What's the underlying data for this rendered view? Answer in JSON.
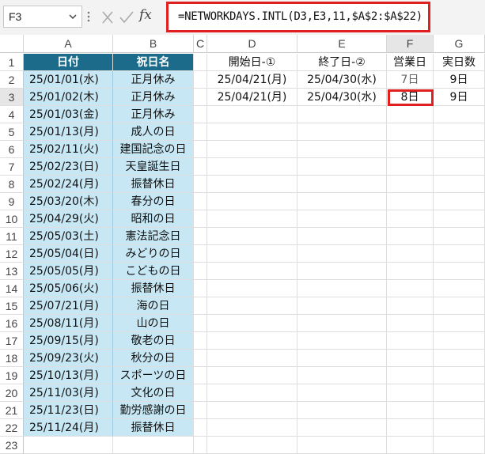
{
  "formula_bar": {
    "name_box": "F3",
    "formula": "=NETWORKDAYS.INTL(D3,E3,11,$A$2:$A$22)",
    "fx_label": "fx"
  },
  "columns": [
    "A",
    "B",
    "C",
    "D",
    "E",
    "F",
    "G"
  ],
  "row_numbers": [
    "1",
    "2",
    "3",
    "4",
    "5",
    "6",
    "7",
    "8",
    "9",
    "10",
    "11",
    "12",
    "13",
    "14",
    "15",
    "16",
    "17",
    "18",
    "19",
    "20",
    "21",
    "22",
    "23"
  ],
  "header_row": {
    "A": "日付",
    "B": "祝日名",
    "D": "開始日-①",
    "E": "終了日-②",
    "F": "営業日",
    "G": "実日数"
  },
  "results": [
    {
      "D": "25/04/21(月)",
      "E": "25/04/30(水)",
      "F": "7日",
      "G": "9日"
    },
    {
      "D": "25/04/21(月)",
      "E": "25/04/30(水)",
      "F": "8日",
      "G": "9日"
    }
  ],
  "holidays": [
    {
      "date": "25/01/01(水)",
      "name": "正月休み"
    },
    {
      "date": "25/01/02(木)",
      "name": "正月休み"
    },
    {
      "date": "25/01/03(金)",
      "name": "正月休み"
    },
    {
      "date": "25/01/13(月)",
      "name": "成人の日"
    },
    {
      "date": "25/02/11(火)",
      "name": "建国記念の日"
    },
    {
      "date": "25/02/23(日)",
      "name": "天皇誕生日"
    },
    {
      "date": "25/02/24(月)",
      "name": "振替休日"
    },
    {
      "date": "25/03/20(木)",
      "name": "春分の日"
    },
    {
      "date": "25/04/29(火)",
      "name": "昭和の日"
    },
    {
      "date": "25/05/03(土)",
      "name": "憲法記念日"
    },
    {
      "date": "25/05/04(日)",
      "name": "みどりの日"
    },
    {
      "date": "25/05/05(月)",
      "name": "こどもの日"
    },
    {
      "date": "25/05/06(火)",
      "name": "振替休日"
    },
    {
      "date": "25/07/21(月)",
      "name": "海の日"
    },
    {
      "date": "25/08/11(月)",
      "name": "山の日"
    },
    {
      "date": "25/09/15(月)",
      "name": "敬老の日"
    },
    {
      "date": "25/09/23(火)",
      "name": "秋分の日"
    },
    {
      "date": "25/10/13(月)",
      "name": "スポーツの日"
    },
    {
      "date": "25/11/03(月)",
      "name": "文化の日"
    },
    {
      "date": "25/11/23(日)",
      "name": "勤労感謝の日"
    },
    {
      "date": "25/11/24(月)",
      "name": "振替休日"
    }
  ],
  "colors": {
    "header_fill": "#1d6b8a",
    "data_fill": "#c7e7f4",
    "highlight": "#e02020"
  }
}
